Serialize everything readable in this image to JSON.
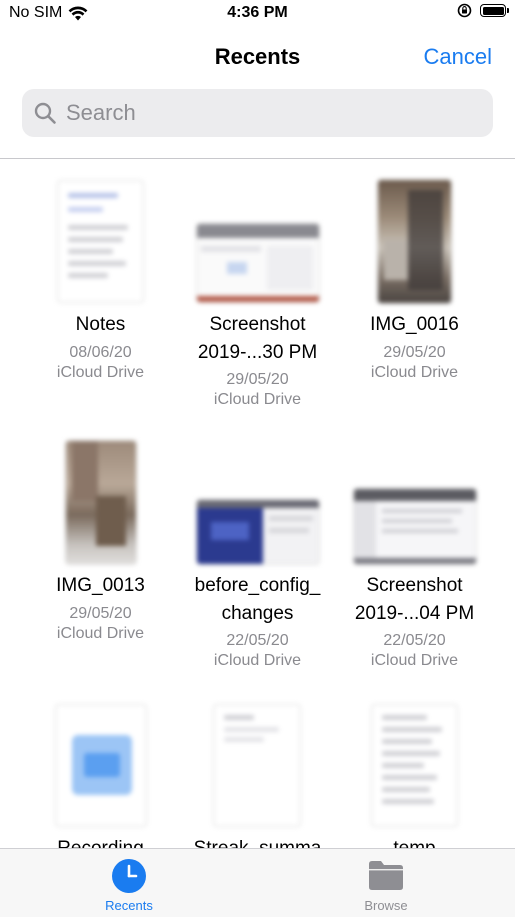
{
  "status": {
    "carrier": "No SIM",
    "time": "4:36 PM"
  },
  "nav": {
    "title": "Recents",
    "cancel_label": "Cancel"
  },
  "search": {
    "placeholder": "Search",
    "value": ""
  },
  "files": [
    {
      "name": "Notes",
      "date": "08/06/20",
      "location": "iCloud Drive",
      "thumb": "document"
    },
    {
      "name": "Screenshot 2019-...30 PM",
      "name_lines": [
        "Screenshot",
        "2019-...30 PM"
      ],
      "date": "29/05/20",
      "location": "iCloud Drive",
      "thumb": "screenshot"
    },
    {
      "name": "IMG_0016",
      "date": "29/05/20",
      "location": "iCloud Drive",
      "thumb": "photo"
    },
    {
      "name": "IMG_0013",
      "date": "29/05/20",
      "location": "iCloud Drive",
      "thumb": "photo"
    },
    {
      "name": "before_config_changes",
      "name_lines": [
        "before_config_",
        "changes"
      ],
      "date": "22/05/20",
      "location": "iCloud Drive",
      "thumb": "screenshot-dark"
    },
    {
      "name": "Screenshot 2019-...04 PM",
      "name_lines": [
        "Screenshot",
        "2019-...04 PM"
      ],
      "date": "22/05/20",
      "location": "iCloud Drive",
      "thumb": "screenshot"
    },
    {
      "name": "Recording",
      "date": "",
      "location": "",
      "thumb": "audio"
    },
    {
      "name": "Streak_summa",
      "date": "",
      "location": "",
      "thumb": "document"
    },
    {
      "name": "temp",
      "date": "",
      "location": "",
      "thumb": "document"
    }
  ],
  "tabs": [
    {
      "label": "Recents",
      "icon": "clock-icon",
      "selected": true
    },
    {
      "label": "Browse",
      "icon": "folder-icon",
      "selected": false
    }
  ],
  "colors": {
    "accent": "#1a7cf0",
    "inactive_tab": "#8e8e93"
  }
}
